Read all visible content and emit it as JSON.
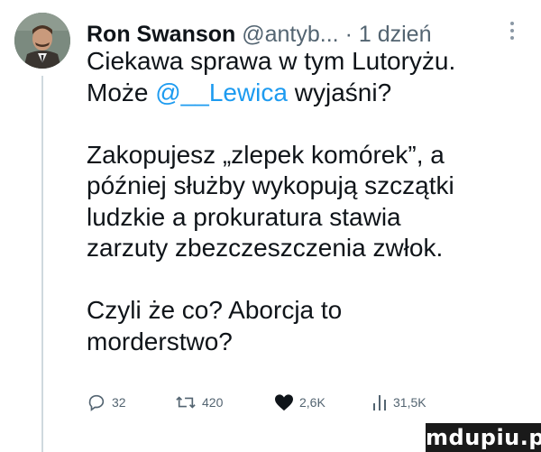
{
  "author": {
    "name": "Ron Swanson",
    "handle": "@antyb...",
    "separator": "·",
    "time": "1 dzień"
  },
  "tweet": {
    "lines": [
      "Ciekawa sprawa w tym Lutoryżu.",
      "",
      "",
      "Zakopujesz „zlepek komórek”, a",
      "później służby wykopują szczątki",
      "ludzkie a prokuratura stawia",
      "zarzuty zbezczeszczenia zwłok.",
      "",
      "Czyli że co? Aborcja to",
      "morderstwo?"
    ],
    "line2_prefix": "Może ",
    "line2_mention": "@__Lewica",
    "line2_suffix": " wyjaśni?"
  },
  "actions": {
    "replies": "32",
    "retweets": "420",
    "likes": "2,6K",
    "views": "31,5K"
  },
  "icons": {
    "reply": "comment-icon",
    "retweet": "retweet-icon",
    "like": "heart-icon",
    "views": "views-chart-icon",
    "more": "more-vertical-icon"
  },
  "colors": {
    "text": "#0f1419",
    "muted": "#536471",
    "mention": "#1d9bf0",
    "thread_line": "#cfd9de"
  },
  "watermark": "mdupiu.pl"
}
